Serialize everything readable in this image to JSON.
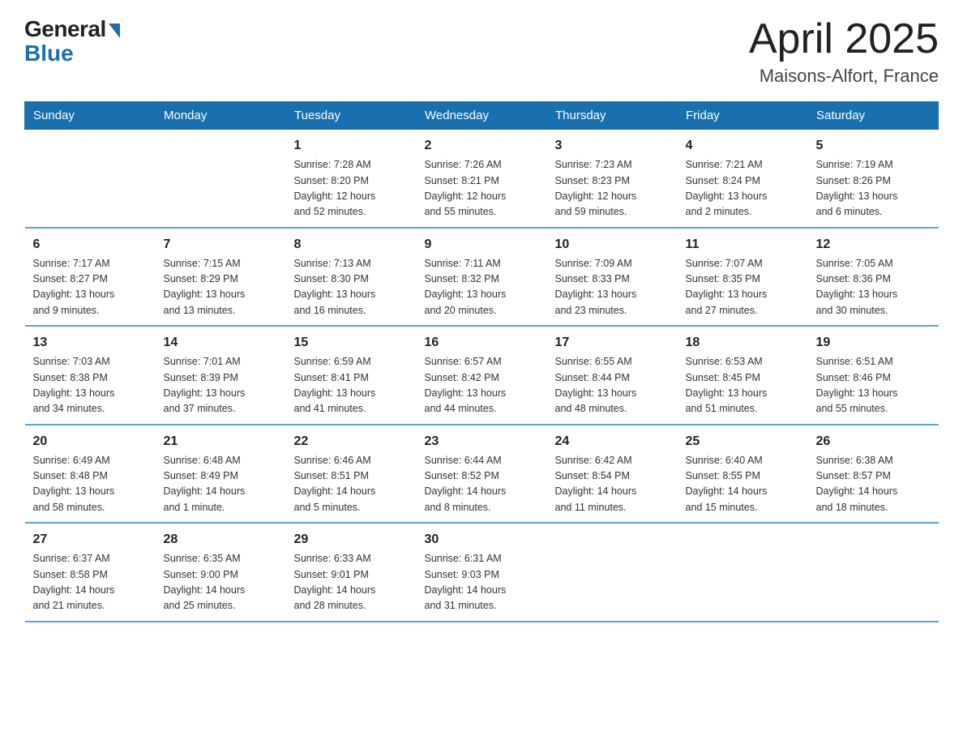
{
  "logo": {
    "general": "General",
    "blue": "Blue"
  },
  "title": {
    "month_year": "April 2025",
    "location": "Maisons-Alfort, France"
  },
  "weekdays": [
    "Sunday",
    "Monday",
    "Tuesday",
    "Wednesday",
    "Thursday",
    "Friday",
    "Saturday"
  ],
  "weeks": [
    [
      {
        "day": "",
        "info": ""
      },
      {
        "day": "",
        "info": ""
      },
      {
        "day": "1",
        "info": "Sunrise: 7:28 AM\nSunset: 8:20 PM\nDaylight: 12 hours\nand 52 minutes."
      },
      {
        "day": "2",
        "info": "Sunrise: 7:26 AM\nSunset: 8:21 PM\nDaylight: 12 hours\nand 55 minutes."
      },
      {
        "day": "3",
        "info": "Sunrise: 7:23 AM\nSunset: 8:23 PM\nDaylight: 12 hours\nand 59 minutes."
      },
      {
        "day": "4",
        "info": "Sunrise: 7:21 AM\nSunset: 8:24 PM\nDaylight: 13 hours\nand 2 minutes."
      },
      {
        "day": "5",
        "info": "Sunrise: 7:19 AM\nSunset: 8:26 PM\nDaylight: 13 hours\nand 6 minutes."
      }
    ],
    [
      {
        "day": "6",
        "info": "Sunrise: 7:17 AM\nSunset: 8:27 PM\nDaylight: 13 hours\nand 9 minutes."
      },
      {
        "day": "7",
        "info": "Sunrise: 7:15 AM\nSunset: 8:29 PM\nDaylight: 13 hours\nand 13 minutes."
      },
      {
        "day": "8",
        "info": "Sunrise: 7:13 AM\nSunset: 8:30 PM\nDaylight: 13 hours\nand 16 minutes."
      },
      {
        "day": "9",
        "info": "Sunrise: 7:11 AM\nSunset: 8:32 PM\nDaylight: 13 hours\nand 20 minutes."
      },
      {
        "day": "10",
        "info": "Sunrise: 7:09 AM\nSunset: 8:33 PM\nDaylight: 13 hours\nand 23 minutes."
      },
      {
        "day": "11",
        "info": "Sunrise: 7:07 AM\nSunset: 8:35 PM\nDaylight: 13 hours\nand 27 minutes."
      },
      {
        "day": "12",
        "info": "Sunrise: 7:05 AM\nSunset: 8:36 PM\nDaylight: 13 hours\nand 30 minutes."
      }
    ],
    [
      {
        "day": "13",
        "info": "Sunrise: 7:03 AM\nSunset: 8:38 PM\nDaylight: 13 hours\nand 34 minutes."
      },
      {
        "day": "14",
        "info": "Sunrise: 7:01 AM\nSunset: 8:39 PM\nDaylight: 13 hours\nand 37 minutes."
      },
      {
        "day": "15",
        "info": "Sunrise: 6:59 AM\nSunset: 8:41 PM\nDaylight: 13 hours\nand 41 minutes."
      },
      {
        "day": "16",
        "info": "Sunrise: 6:57 AM\nSunset: 8:42 PM\nDaylight: 13 hours\nand 44 minutes."
      },
      {
        "day": "17",
        "info": "Sunrise: 6:55 AM\nSunset: 8:44 PM\nDaylight: 13 hours\nand 48 minutes."
      },
      {
        "day": "18",
        "info": "Sunrise: 6:53 AM\nSunset: 8:45 PM\nDaylight: 13 hours\nand 51 minutes."
      },
      {
        "day": "19",
        "info": "Sunrise: 6:51 AM\nSunset: 8:46 PM\nDaylight: 13 hours\nand 55 minutes."
      }
    ],
    [
      {
        "day": "20",
        "info": "Sunrise: 6:49 AM\nSunset: 8:48 PM\nDaylight: 13 hours\nand 58 minutes."
      },
      {
        "day": "21",
        "info": "Sunrise: 6:48 AM\nSunset: 8:49 PM\nDaylight: 14 hours\nand 1 minute."
      },
      {
        "day": "22",
        "info": "Sunrise: 6:46 AM\nSunset: 8:51 PM\nDaylight: 14 hours\nand 5 minutes."
      },
      {
        "day": "23",
        "info": "Sunrise: 6:44 AM\nSunset: 8:52 PM\nDaylight: 14 hours\nand 8 minutes."
      },
      {
        "day": "24",
        "info": "Sunrise: 6:42 AM\nSunset: 8:54 PM\nDaylight: 14 hours\nand 11 minutes."
      },
      {
        "day": "25",
        "info": "Sunrise: 6:40 AM\nSunset: 8:55 PM\nDaylight: 14 hours\nand 15 minutes."
      },
      {
        "day": "26",
        "info": "Sunrise: 6:38 AM\nSunset: 8:57 PM\nDaylight: 14 hours\nand 18 minutes."
      }
    ],
    [
      {
        "day": "27",
        "info": "Sunrise: 6:37 AM\nSunset: 8:58 PM\nDaylight: 14 hours\nand 21 minutes."
      },
      {
        "day": "28",
        "info": "Sunrise: 6:35 AM\nSunset: 9:00 PM\nDaylight: 14 hours\nand 25 minutes."
      },
      {
        "day": "29",
        "info": "Sunrise: 6:33 AM\nSunset: 9:01 PM\nDaylight: 14 hours\nand 28 minutes."
      },
      {
        "day": "30",
        "info": "Sunrise: 6:31 AM\nSunset: 9:03 PM\nDaylight: 14 hours\nand 31 minutes."
      },
      {
        "day": "",
        "info": ""
      },
      {
        "day": "",
        "info": ""
      },
      {
        "day": "",
        "info": ""
      }
    ]
  ]
}
